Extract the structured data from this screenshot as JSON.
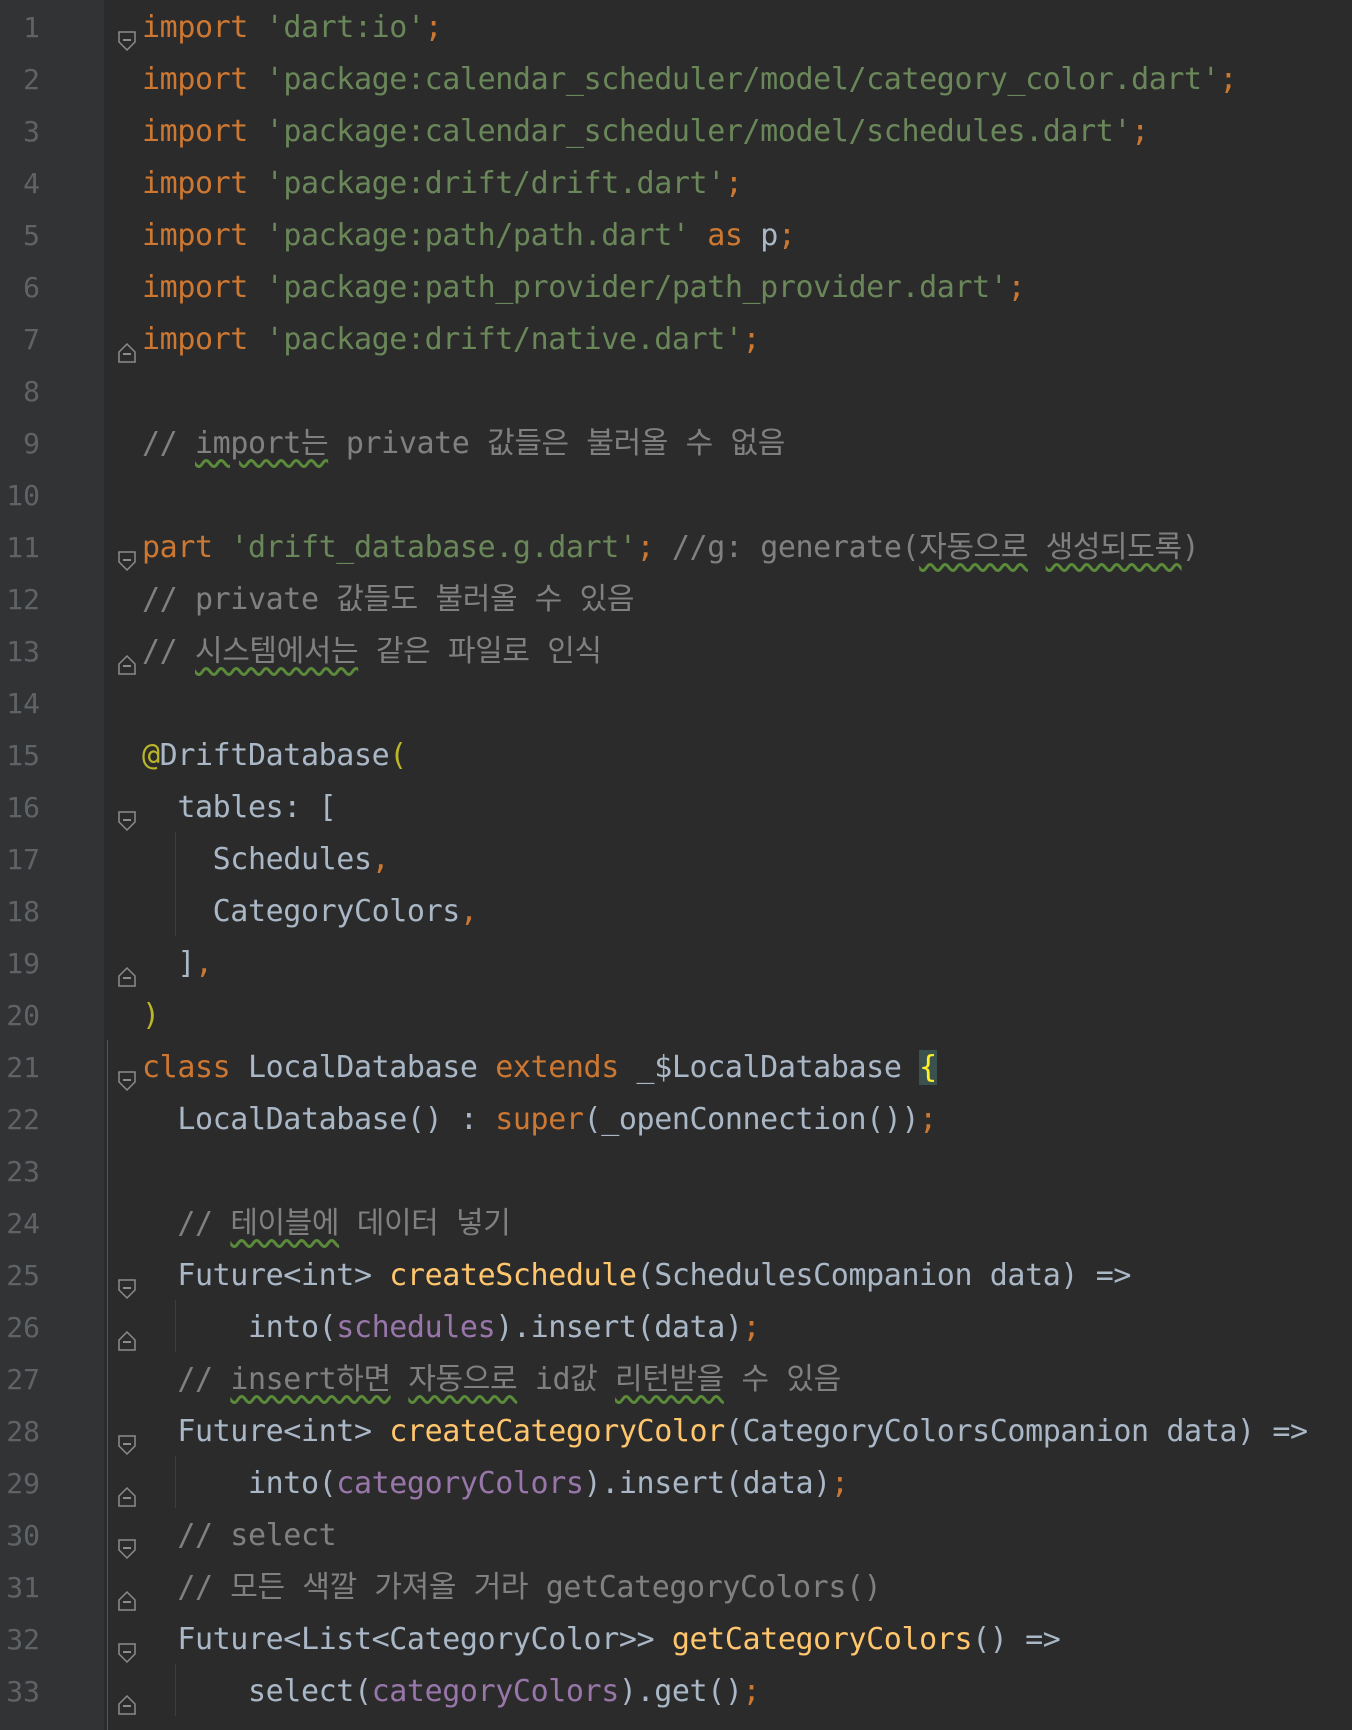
{
  "editor": {
    "language": "dart",
    "colors": {
      "background": "#2b2b2b",
      "keyword": "#cc7832",
      "string": "#6a8759",
      "comment": "#808080",
      "function": "#ffc66d",
      "annotation": "#bbb529",
      "field": "#9876aa",
      "identifier": "#a9b7c6"
    },
    "lines": [
      {
        "n": "1",
        "fold": "start",
        "tokens": [
          [
            "kw",
            "import"
          ],
          [
            "id",
            " "
          ],
          [
            "str",
            "'dart:io'"
          ],
          [
            "kw",
            ";"
          ]
        ]
      },
      {
        "n": "2",
        "fold": "",
        "tokens": [
          [
            "kw",
            "import"
          ],
          [
            "id",
            " "
          ],
          [
            "str",
            "'package:calendar_scheduler/model/category_color.dart'"
          ],
          [
            "kw",
            ";"
          ]
        ]
      },
      {
        "n": "3",
        "fold": "",
        "tokens": [
          [
            "kw",
            "import"
          ],
          [
            "id",
            " "
          ],
          [
            "str",
            "'package:calendar_scheduler/model/schedules.dart'"
          ],
          [
            "kw",
            ";"
          ]
        ]
      },
      {
        "n": "4",
        "fold": "",
        "tokens": [
          [
            "kw",
            "import"
          ],
          [
            "id",
            " "
          ],
          [
            "str",
            "'package:drift/drift.dart'"
          ],
          [
            "kw",
            ";"
          ]
        ]
      },
      {
        "n": "5",
        "fold": "",
        "tokens": [
          [
            "kw",
            "import"
          ],
          [
            "id",
            " "
          ],
          [
            "str",
            "'package:path/path.dart'"
          ],
          [
            "id",
            " "
          ],
          [
            "kw",
            "as"
          ],
          [
            "id",
            " p"
          ],
          [
            "kw",
            ";"
          ]
        ]
      },
      {
        "n": "6",
        "fold": "",
        "tokens": [
          [
            "kw",
            "import"
          ],
          [
            "id",
            " "
          ],
          [
            "str",
            "'package:path_provider/path_provider.dart'"
          ],
          [
            "kw",
            ";"
          ]
        ]
      },
      {
        "n": "7",
        "fold": "end",
        "tokens": [
          [
            "kw",
            "import"
          ],
          [
            "id",
            " "
          ],
          [
            "str",
            "'package:drift/native.dart'"
          ],
          [
            "kw",
            ";"
          ]
        ]
      },
      {
        "n": "8",
        "fold": "",
        "tokens": []
      },
      {
        "n": "9",
        "fold": "",
        "tokens": [
          [
            "cm",
            "// "
          ],
          [
            "cmsq",
            "import는"
          ],
          [
            "cm",
            " private 값들은 불러올 수 없음"
          ]
        ]
      },
      {
        "n": "10",
        "fold": "",
        "tokens": []
      },
      {
        "n": "11",
        "fold": "start",
        "tokens": [
          [
            "kw",
            "part"
          ],
          [
            "id",
            " "
          ],
          [
            "str",
            "'drift_database.g.dart'"
          ],
          [
            "kw",
            ";"
          ],
          [
            "cm",
            " //g: generate("
          ],
          [
            "cmsq",
            "자동으로"
          ],
          [
            "cm",
            " "
          ],
          [
            "cmsq",
            "생성되도록"
          ],
          [
            "cm",
            ")"
          ]
        ]
      },
      {
        "n": "12",
        "fold": "",
        "tokens": [
          [
            "cm",
            "// private 값들도 불러올 수 있음"
          ]
        ]
      },
      {
        "n": "13",
        "fold": "end",
        "tokens": [
          [
            "cm",
            "// "
          ],
          [
            "cmsq",
            "시스템에서는"
          ],
          [
            "cm",
            " 같은 파일로 인식"
          ]
        ]
      },
      {
        "n": "14",
        "fold": "",
        "tokens": []
      },
      {
        "n": "15",
        "fold": "",
        "tokens": [
          [
            "ann",
            "@"
          ],
          [
            "id",
            "DriftDatabase"
          ],
          [
            "ann",
            "("
          ]
        ]
      },
      {
        "n": "16",
        "fold": "start",
        "tokens": [
          [
            "id",
            "  tables: ["
          ]
        ]
      },
      {
        "n": "17",
        "fold": "",
        "tokens": [
          [
            "id",
            "    Schedules"
          ],
          [
            "kw",
            ","
          ]
        ]
      },
      {
        "n": "18",
        "fold": "",
        "tokens": [
          [
            "id",
            "    CategoryColors"
          ],
          [
            "kw",
            ","
          ]
        ]
      },
      {
        "n": "19",
        "fold": "end",
        "tokens": [
          [
            "id",
            "  ]"
          ],
          [
            "kw",
            ","
          ]
        ]
      },
      {
        "n": "20",
        "fold": "",
        "tokens": [
          [
            "ann",
            ")"
          ]
        ]
      },
      {
        "n": "21",
        "fold": "start",
        "tokens": [
          [
            "kw",
            "class"
          ],
          [
            "id",
            " LocalDatabase "
          ],
          [
            "kw",
            "extends"
          ],
          [
            "id",
            " _$LocalDatabase "
          ],
          [
            "hl",
            "{"
          ]
        ]
      },
      {
        "n": "22",
        "fold": "",
        "tokens": [
          [
            "id",
            "  LocalDatabase() : "
          ],
          [
            "kw",
            "super"
          ],
          [
            "id",
            "(_openConnection())"
          ],
          [
            "kw",
            ";"
          ]
        ]
      },
      {
        "n": "23",
        "fold": "",
        "tokens": []
      },
      {
        "n": "24",
        "fold": "",
        "tokens": [
          [
            "cm",
            "  // "
          ],
          [
            "cmsq",
            "테이블에"
          ],
          [
            "cm",
            " 데이터 넣기"
          ]
        ]
      },
      {
        "n": "25",
        "fold": "start",
        "tokens": [
          [
            "id",
            "  Future<int> "
          ],
          [
            "fn",
            "createSchedule"
          ],
          [
            "id",
            "(SchedulesCompanion data) =>"
          ]
        ]
      },
      {
        "n": "26",
        "fold": "end",
        "tokens": [
          [
            "id",
            "      into("
          ],
          [
            "fld",
            "schedules"
          ],
          [
            "id",
            ").insert(data)"
          ],
          [
            "kw",
            ";"
          ]
        ]
      },
      {
        "n": "27",
        "fold": "",
        "tokens": [
          [
            "cm",
            "  // "
          ],
          [
            "cmsq",
            "insert하면"
          ],
          [
            "cm",
            " "
          ],
          [
            "cmsq",
            "자동으로"
          ],
          [
            "cm",
            " id값 "
          ],
          [
            "cmsq",
            "리턴받을"
          ],
          [
            "cm",
            " 수 있음"
          ]
        ]
      },
      {
        "n": "28",
        "fold": "start",
        "tokens": [
          [
            "id",
            "  Future<int> "
          ],
          [
            "fn",
            "createCategoryColor"
          ],
          [
            "id",
            "(CategoryColorsCompanion data) =>"
          ]
        ]
      },
      {
        "n": "29",
        "fold": "end",
        "tokens": [
          [
            "id",
            "      into("
          ],
          [
            "fld",
            "categoryColors"
          ],
          [
            "id",
            ").insert(data)"
          ],
          [
            "kw",
            ";"
          ]
        ]
      },
      {
        "n": "30",
        "fold": "start",
        "tokens": [
          [
            "cm",
            "  // select"
          ]
        ]
      },
      {
        "n": "31",
        "fold": "end",
        "tokens": [
          [
            "cm",
            "  // 모든 색깔 가져올 거라 getCategoryColors()"
          ]
        ]
      },
      {
        "n": "32",
        "fold": "start",
        "tokens": [
          [
            "id",
            "  Future<List<CategoryColor>> "
          ],
          [
            "fn",
            "getCategoryColors"
          ],
          [
            "id",
            "() =>"
          ]
        ]
      },
      {
        "n": "33",
        "fold": "end",
        "tokens": [
          [
            "id",
            "      select("
          ],
          [
            "fld",
            "categoryColors"
          ],
          [
            "id",
            ").get()"
          ],
          [
            "kw",
            ";"
          ]
        ]
      }
    ]
  }
}
